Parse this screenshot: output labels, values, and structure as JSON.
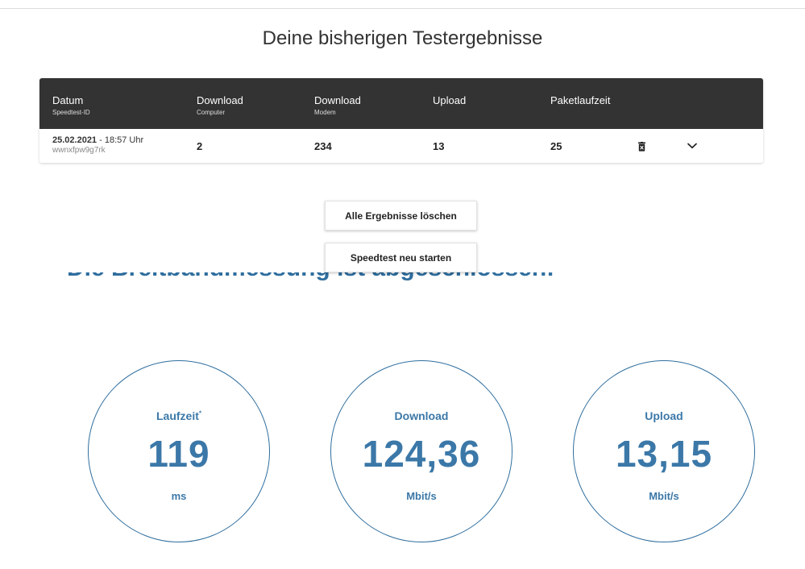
{
  "header": {
    "title": "Deine bisherigen Testergebnisse"
  },
  "results_table": {
    "columns": [
      {
        "label": "Datum",
        "sublabel": "Speedtest-ID"
      },
      {
        "label": "Download",
        "sublabel": "Computer"
      },
      {
        "label": "Download",
        "sublabel": "Modem"
      },
      {
        "label": "Upload",
        "sublabel": ""
      },
      {
        "label": "Paketlaufzeit",
        "sublabel": ""
      }
    ],
    "rows": [
      {
        "date": "25.02.2021",
        "time": " - 18:57 Uhr",
        "speedtest_id": "wwnxfpw9g7rk",
        "download_computer": "2",
        "download_modem": "234",
        "upload": "13",
        "paketlaufzeit": "25",
        "delete_icon": "trash-icon",
        "expand_icon": "chevron-down-icon"
      }
    ]
  },
  "actions": {
    "delete_all_label": "Alle Ergebnisse löschen",
    "restart_label": "Speedtest neu starten"
  },
  "obscured_heading": "Die Breitbandmessung ist abgeschlossen!",
  "gauges": [
    {
      "label": "Laufzeit",
      "marker": "*",
      "value": "119",
      "unit": "ms"
    },
    {
      "label": "Download",
      "marker": "",
      "value": "124,36",
      "unit": "Mbit/s"
    },
    {
      "label": "Upload",
      "marker": "",
      "value": "13,15",
      "unit": "Mbit/s"
    }
  ],
  "colors": {
    "table_header_bg": "#333333",
    "accent_blue": "#3b78a8",
    "gauge_border": "#2f6e9e"
  }
}
